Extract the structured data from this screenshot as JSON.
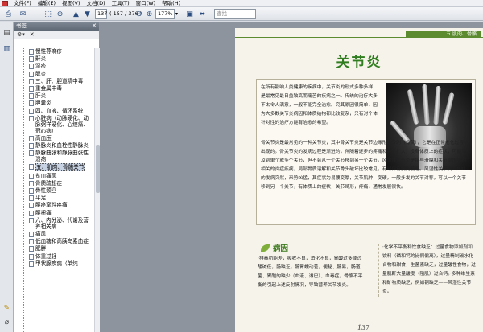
{
  "menu": [
    "文件(F)",
    "编辑(E)",
    "视图(V)",
    "文档(D)",
    "工具(T)",
    "窗口(W)",
    "帮助(H)"
  ],
  "toolbar": {
    "page_input": "137",
    "page_total": "( 157 / 376 )",
    "zoom": "177%",
    "search_placeholder": "查找"
  },
  "panel": {
    "title": "书签",
    "items": [
      {
        "label": "慢性荨麻疹",
        "level": 1
      },
      {
        "label": "鼾炎",
        "level": 1
      },
      {
        "label": "湿疹",
        "level": 1
      },
      {
        "label": "腮炎",
        "level": 1
      },
      {
        "label": "三、肝、胆道精中毒",
        "level": 1
      },
      {
        "label": "重金属中毒",
        "level": 1
      },
      {
        "label": "肝炎",
        "level": 1
      },
      {
        "label": "胆囊炎",
        "level": 1
      },
      {
        "label": "四、血液、循环系统",
        "level": 0
      },
      {
        "label": "心脏病（动脉硬化、动脉粥样硬化、心绞痛、冠心病）",
        "level": 1
      },
      {
        "label": "高血压",
        "level": 1
      },
      {
        "label": "静脉炎和血栓性静脉炎",
        "level": 1
      },
      {
        "label": "静脉曲张和静脉曲张性溃疡",
        "level": 1
      },
      {
        "label": "五、肌肉、骨骼关节",
        "level": 0,
        "selected": true
      },
      {
        "label": "贫血痛风",
        "level": 1
      },
      {
        "label": "骨质疏松症",
        "level": 1
      },
      {
        "label": "骨性颈凸",
        "level": 1
      },
      {
        "label": "平足",
        "level": 1
      },
      {
        "label": "腰痉挛性疼痛",
        "level": 1
      },
      {
        "label": "腰扭痛",
        "level": 1
      },
      {
        "label": "六、内分泌、代谢及营养相关病",
        "level": 0
      },
      {
        "label": "痛风",
        "level": 1
      },
      {
        "label": "低血糖和高胰岛素血症",
        "level": 1
      },
      {
        "label": "肥胖",
        "level": 1
      },
      {
        "label": "体重过轻",
        "level": 1
      },
      {
        "label": "甲状腺疾病（单纯",
        "level": 1
      }
    ]
  },
  "page": {
    "section_band": "五 肌肉、骨骼",
    "title": "关节炎",
    "intro_p1": "在所有影响人类健康的疾病中，关节炎的形式多种多样，是最常见最日益致高而痛苦的疾病之一。传统的治疗大多不太令人满意，一般不能完全治愈。究其原因很简单，因为大多数关节炎病因和体质结构都比较复杂，只有对个体针对性的治疗方能有治愈的希望。",
    "intro_p2": "骨关节炎是最常见的一种关节炎，其中骨关节炎是关节边缘形成骨刺（骨赘），它是在正常老化过程中出现的。骨关节炎的发病过程是渐进的，伴随着逐步的疼痛和关节扩大，没有体质上的症状，可能涉及到单个或多个关节，但不会从一个关节移到另一个关节。风湿性关节炎是指与滑膜和关节周围结构相关的炎症疾病，局部骨质溶解和关节骨头破坏比较常见，有时伴有肌肉萎缩。风湿性关节炎（RA）的发病突然，来势凶猛，其症状为易腰变厚，关节肌肿，变硬，一般多发的关节对称，可以一个关节移到另一个关节，有体质上的症状，关节畸形，疼痛，通常发展很快。",
    "section_title": "病因",
    "left_col": "·排毒功能差，吸收不良，消化不良，胃酸过多或过酸碱低，肠缺乏，肠胃蠕动差，便秘、肠易，肠道菌、胃酸的缺少（血液、淋巴）、血毒症，骨骼不平衡的引起上述反射情况，导致营养关节发炎。",
    "right_col": "·化学不平衡和饮食缺乏：过量食物添加剂和饮料（磷和钙的比例偏离），过量精制碳水化合物和甜食，生菌素缺乏，过量酸性食物，过量肌酐大量酸度（阻肌）过合钙。·多种维生素和矿物质缺乏，例如铜缺乏——风湿性关节炎。",
    "page_number": "137"
  }
}
